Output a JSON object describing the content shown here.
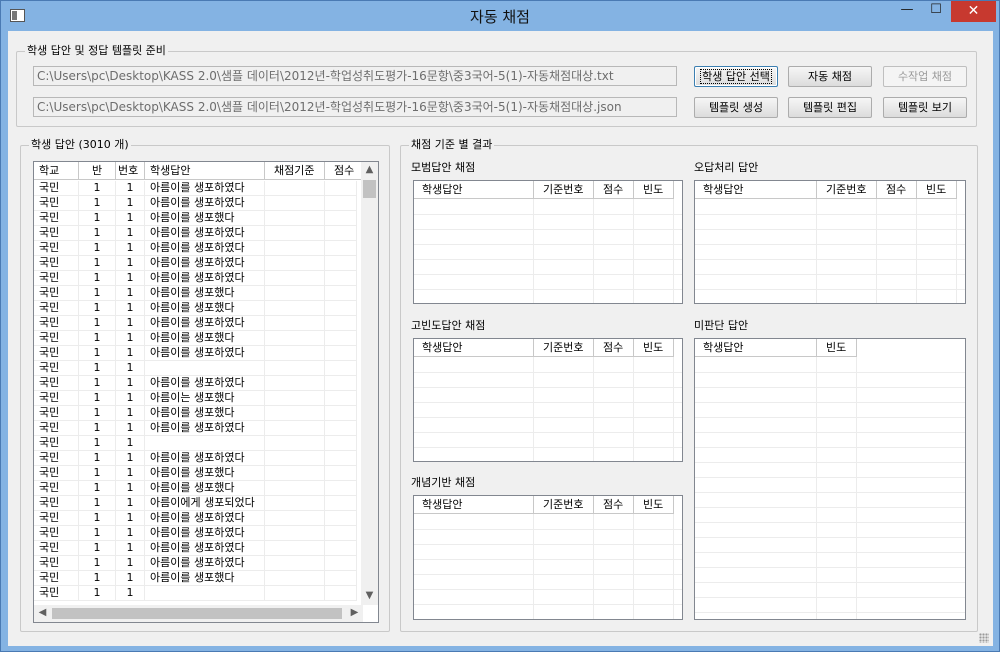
{
  "window": {
    "title": "자동 채점",
    "min_glyph": "—",
    "max_glyph": "☐",
    "close_glyph": "✕"
  },
  "prep": {
    "label": "학생 답안 및 정답 템플릿 준비",
    "student_path": "C:\\Users\\pc\\Desktop\\KASS 2.0\\샘플 데이터\\2012년-학업성취도평가-16문항\\중3국어-5(1)-자동채점대상.txt",
    "template_path": "C:\\Users\\pc\\Desktop\\KASS 2.0\\샘플 데이터\\2012년-학업성취도평가-16문항\\중3국어-5(1)-자동채점대상.json",
    "buttons": {
      "select_answers": "학생 답안 선택",
      "auto_grade": "자동 채점",
      "manual_grade": "수작업 채점",
      "create_template": "템플릿 생성",
      "edit_template": "템플릿 편집",
      "view_template": "템플릿 보기"
    }
  },
  "answers": {
    "label": "학생 답안 (3010 개)",
    "columns": [
      "학교",
      "반",
      "번호",
      "학생답안",
      "채점기준",
      "점수"
    ],
    "rows": [
      [
        "국민",
        "1",
        "1",
        "아름이를 생포하였다"
      ],
      [
        "국민",
        "1",
        "1",
        "아름이를 생포하였다"
      ],
      [
        "국민",
        "1",
        "1",
        "아름이를 생포했다"
      ],
      [
        "국민",
        "1",
        "1",
        "아름이를 생포하였다"
      ],
      [
        "국민",
        "1",
        "1",
        "아름이를 생포하였다"
      ],
      [
        "국민",
        "1",
        "1",
        "아름이를 생포하였다"
      ],
      [
        "국민",
        "1",
        "1",
        "아름이를 생포하였다"
      ],
      [
        "국민",
        "1",
        "1",
        "아름이를 생포했다"
      ],
      [
        "국민",
        "1",
        "1",
        "아름이를 생포했다"
      ],
      [
        "국민",
        "1",
        "1",
        "아름이를 생포하였다"
      ],
      [
        "국민",
        "1",
        "1",
        "아름이를 생포했다"
      ],
      [
        "국민",
        "1",
        "1",
        "아름이를 생포하였다"
      ],
      [
        "국민",
        "1",
        "1",
        ""
      ],
      [
        "국민",
        "1",
        "1",
        "아름이를 생포하였다"
      ],
      [
        "국민",
        "1",
        "1",
        "아름이는 생포했다"
      ],
      [
        "국민",
        "1",
        "1",
        "아름이를 생포했다"
      ],
      [
        "국민",
        "1",
        "1",
        "아름이를 생포하였다"
      ],
      [
        "국민",
        "1",
        "1",
        ""
      ],
      [
        "국민",
        "1",
        "1",
        "아름이를 생포하였다"
      ],
      [
        "국민",
        "1",
        "1",
        "아름이를 생포했다"
      ],
      [
        "국민",
        "1",
        "1",
        "아름이를 생포했다"
      ],
      [
        "국민",
        "1",
        "1",
        "아름이에게 생포되었다"
      ],
      [
        "국민",
        "1",
        "1",
        "아름이를 생포하였다"
      ],
      [
        "국민",
        "1",
        "1",
        "아름이를 생포하였다"
      ],
      [
        "국민",
        "1",
        "1",
        "아름이를 생포하였다"
      ],
      [
        "국민",
        "1",
        "1",
        "아름이를 생포하였다"
      ],
      [
        "국민",
        "1",
        "1",
        "아름이를 생포했다"
      ],
      [
        "국민",
        "1",
        "1",
        ""
      ]
    ]
  },
  "results": {
    "label": "채점 기준 별 결과",
    "model": {
      "label": "모범답안 채점",
      "columns": [
        "학생답안",
        "기준번호",
        "점수",
        "빈도"
      ]
    },
    "wrong": {
      "label": "오답처리 답안",
      "columns": [
        "학생답안",
        "기준번호",
        "점수",
        "빈도"
      ]
    },
    "frequent": {
      "label": "고빈도답안 채점",
      "columns": [
        "학생답안",
        "기준번호",
        "점수",
        "빈도"
      ]
    },
    "undecided": {
      "label": "미판단 답안",
      "columns": [
        "학생답안",
        "빈도"
      ]
    },
    "concept": {
      "label": "개념기반 채점",
      "columns": [
        "학생답안",
        "기준번호",
        "점수",
        "빈도"
      ]
    }
  }
}
